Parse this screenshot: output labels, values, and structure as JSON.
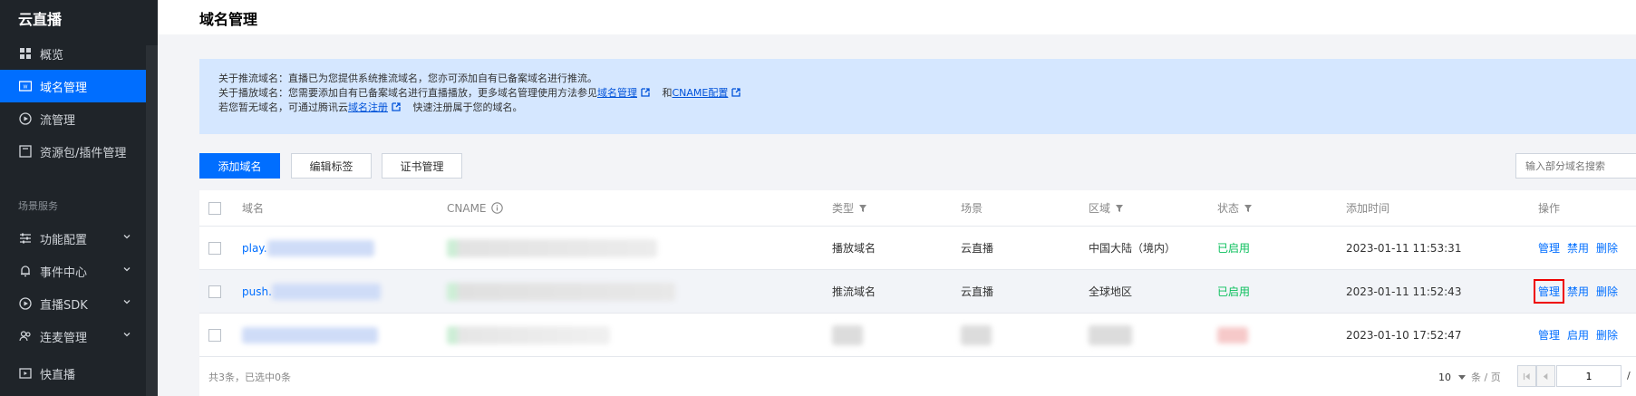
{
  "sidebar": {
    "title": "云直播",
    "items": [
      {
        "label": "概览"
      },
      {
        "label": "域名管理"
      },
      {
        "label": "流管理"
      },
      {
        "label": "资源包/插件管理"
      }
    ],
    "section_label": "场景服务",
    "section_items": [
      {
        "label": "功能配置"
      },
      {
        "label": "事件中心"
      },
      {
        "label": "直播SDK"
      },
      {
        "label": "连麦管理"
      },
      {
        "label": "快直播"
      }
    ]
  },
  "header": {
    "title": "域名管理"
  },
  "notice": {
    "line1": "关于推流域名：直播已为您提供系统推流域名，您亦可添加自有已备案域名进行推流。",
    "line2_prefix": "关于播放域名：您需要添加自有已备案域名进行直播播放，更多域名管理使用方法参见",
    "line2_link1": "域名管理",
    "line2_and": "和",
    "line2_link2": "CNAME配置",
    "line3_prefix": "若您暂无域名，可通过腾讯云",
    "line3_link": "域名注册",
    "line3_suffix": "快速注册属于您的域名。"
  },
  "toolbar": {
    "add_label": "添加域名",
    "edit_tags_label": "编辑标签",
    "cert_label": "证书管理",
    "search_placeholder": "输入部分域名搜索"
  },
  "table": {
    "columns": {
      "domain": "域名",
      "cname": "CNAME",
      "type": "类型",
      "scene": "场景",
      "region": "区域",
      "status": "状态",
      "added": "添加时间",
      "actions": "操作"
    },
    "rows": [
      {
        "domain": "play.",
        "type": "播放域名",
        "scene": "云直播",
        "region": "中国大陆（境内）",
        "status": "已启用",
        "added": "2023-01-11 11:53:31",
        "actions": [
          "管理",
          "禁用",
          "删除"
        ]
      },
      {
        "domain": "push.",
        "type": "推流域名",
        "scene": "云直播",
        "region": "全球地区",
        "status": "已启用",
        "added": "2023-01-11 11:52:43",
        "actions": [
          "管理",
          "禁用",
          "删除"
        ]
      },
      {
        "domain": "",
        "type": "",
        "scene": "",
        "region": "",
        "status": "",
        "added": "2023-01-10 17:52:47",
        "actions": [
          "管理",
          "启用",
          "删除"
        ]
      }
    ]
  },
  "footer": {
    "count_text": "共3条，已选中0条",
    "page_size": "10",
    "page_size_unit": "条 / 页",
    "current_page": "1",
    "page_separator": "/"
  },
  "colors": {
    "sidebar_bg": "#1f2429",
    "accent": "#006eff",
    "notice_bg": "#d5e7ff",
    "status_green": "#0abf5b",
    "highlight_red": "#e00000"
  }
}
